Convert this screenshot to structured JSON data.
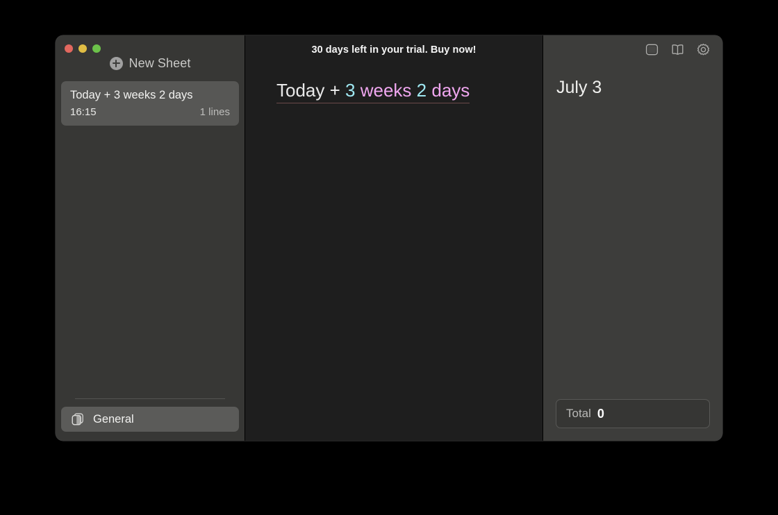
{
  "window": {
    "traffic_lights": [
      {
        "name": "close",
        "color": "#e2685f"
      },
      {
        "name": "minimize",
        "color": "#e0bd44"
      },
      {
        "name": "maximize",
        "color": "#6cc24a"
      }
    ]
  },
  "sidebar": {
    "new_sheet_label": "New Sheet",
    "new_sheet_icon": "plus-circle-icon",
    "sheets": [
      {
        "title": "Today + 3 weeks 2 days",
        "time": "16:15",
        "lines": "1 lines",
        "selected": true
      }
    ],
    "footer": {
      "icon": "stacked-sheets-icon",
      "label": "General"
    }
  },
  "editor": {
    "trial_banner": "30 days left in your trial. Buy now!",
    "expression_tokens": [
      {
        "text": "Today",
        "kind": "plain"
      },
      {
        "text": " + ",
        "kind": "op"
      },
      {
        "text": "3",
        "kind": "num"
      },
      {
        "text": " ",
        "kind": "plain"
      },
      {
        "text": "weeks",
        "kind": "unit"
      },
      {
        "text": " ",
        "kind": "plain"
      },
      {
        "text": "2",
        "kind": "num"
      },
      {
        "text": " ",
        "kind": "plain"
      },
      {
        "text": "days",
        "kind": "unit"
      }
    ],
    "expression_plain": "Today + 3 weeks 2 days"
  },
  "results": {
    "toolbar_icons": [
      {
        "name": "sidebar-toggle-icon"
      },
      {
        "name": "book-icon"
      },
      {
        "name": "gear-icon"
      }
    ],
    "values": [
      "July 3"
    ],
    "total_label": "Total",
    "total_value": "0"
  },
  "colors": {
    "accent_number": "#9fe8f2",
    "accent_unit": "#efa6ef",
    "sidebar_bg": "#373735",
    "editor_bg": "#1e1e1e",
    "results_bg": "#3d3d3b",
    "selection_bg": "#575755"
  }
}
